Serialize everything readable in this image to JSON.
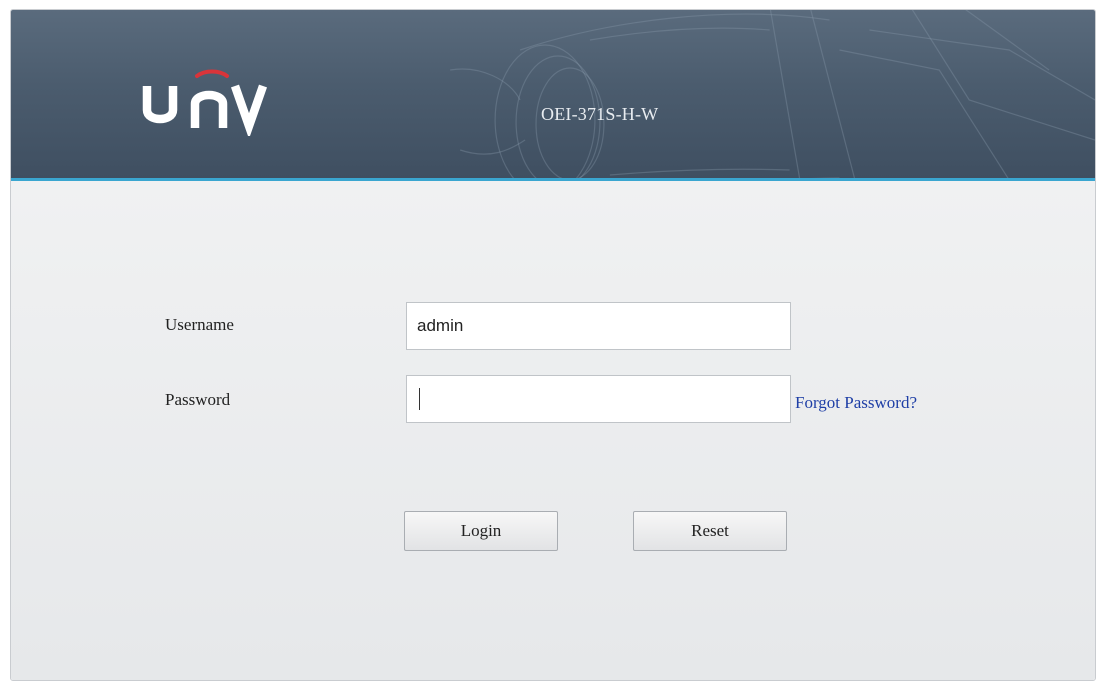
{
  "header": {
    "brand": "UNV",
    "model": "OEI-371S-H-W",
    "accent_color": "#3aa6d0",
    "logo_arc_color": "#d9343a"
  },
  "form": {
    "username_label": "Username",
    "username_value": "admin",
    "password_label": "Password",
    "password_value": "",
    "forgot_password_label": "Forgot Password?",
    "login_label": "Login",
    "reset_label": "Reset"
  }
}
